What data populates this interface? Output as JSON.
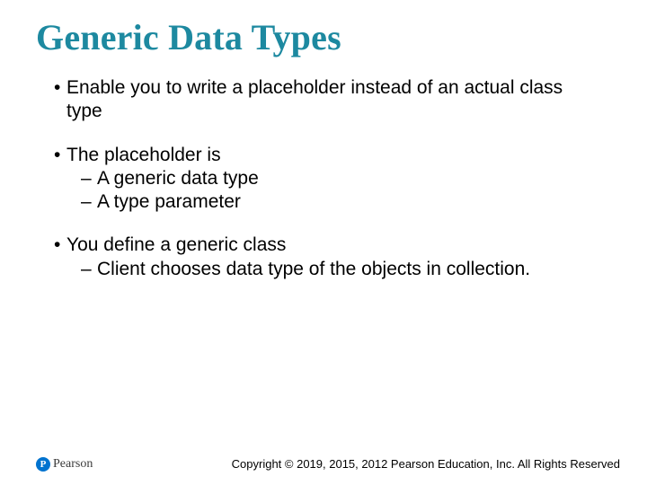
{
  "title": "Generic Data Types",
  "bullets": [
    {
      "text": "Enable you to write a placeholder instead of an actual class type",
      "subs": []
    },
    {
      "text": "The placeholder is",
      "subs": [
        "A generic data type",
        "A type parameter"
      ]
    },
    {
      "text": "You define a generic class",
      "subs": [
        "Client chooses data type of the objects in collection."
      ]
    }
  ],
  "logo_text": "Pearson",
  "copyright": "Copyright © 2019, 2015, 2012 Pearson Education, Inc. All Rights Reserved"
}
